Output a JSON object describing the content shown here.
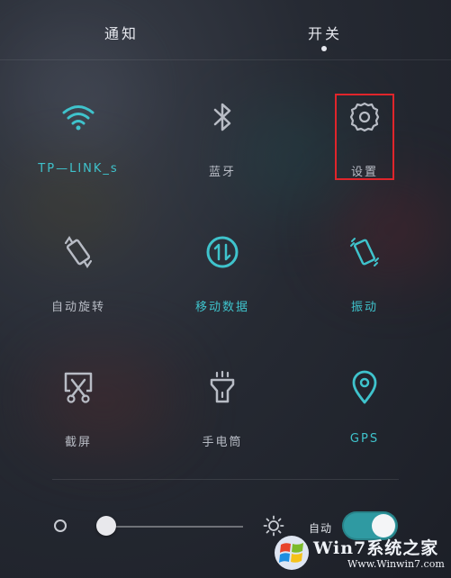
{
  "tabs": {
    "notify": "通知",
    "switch": "开关",
    "active": "开关"
  },
  "tiles": [
    {
      "label": "TP—LINK_s",
      "icon": "wifi-icon",
      "state": "on"
    },
    {
      "label": "蓝牙",
      "icon": "bluetooth-icon",
      "state": "off"
    },
    {
      "label": "设置",
      "icon": "gear-icon",
      "state": "off"
    },
    {
      "label": "自动旋转",
      "icon": "auto-rotate-icon",
      "state": "off"
    },
    {
      "label": "移动数据",
      "icon": "mobile-data-icon",
      "state": "on"
    },
    {
      "label": "振动",
      "icon": "vibrate-icon",
      "state": "on"
    },
    {
      "label": "截屏",
      "icon": "screenshot-icon",
      "state": "off"
    },
    {
      "label": "手电筒",
      "icon": "flashlight-icon",
      "state": "off"
    },
    {
      "label": "GPS",
      "icon": "location-pin-icon",
      "state": "on"
    }
  ],
  "brightness": {
    "level": 0.05,
    "auto_label": "自动",
    "auto_enabled": true
  },
  "watermark": {
    "brand": "Win7系统之家",
    "url": "Www.Winwin7.com"
  },
  "colors": {
    "accent": "#3fc3cc",
    "highlight": "#e0252b",
    "toggle_on": "#2f9aa2"
  }
}
